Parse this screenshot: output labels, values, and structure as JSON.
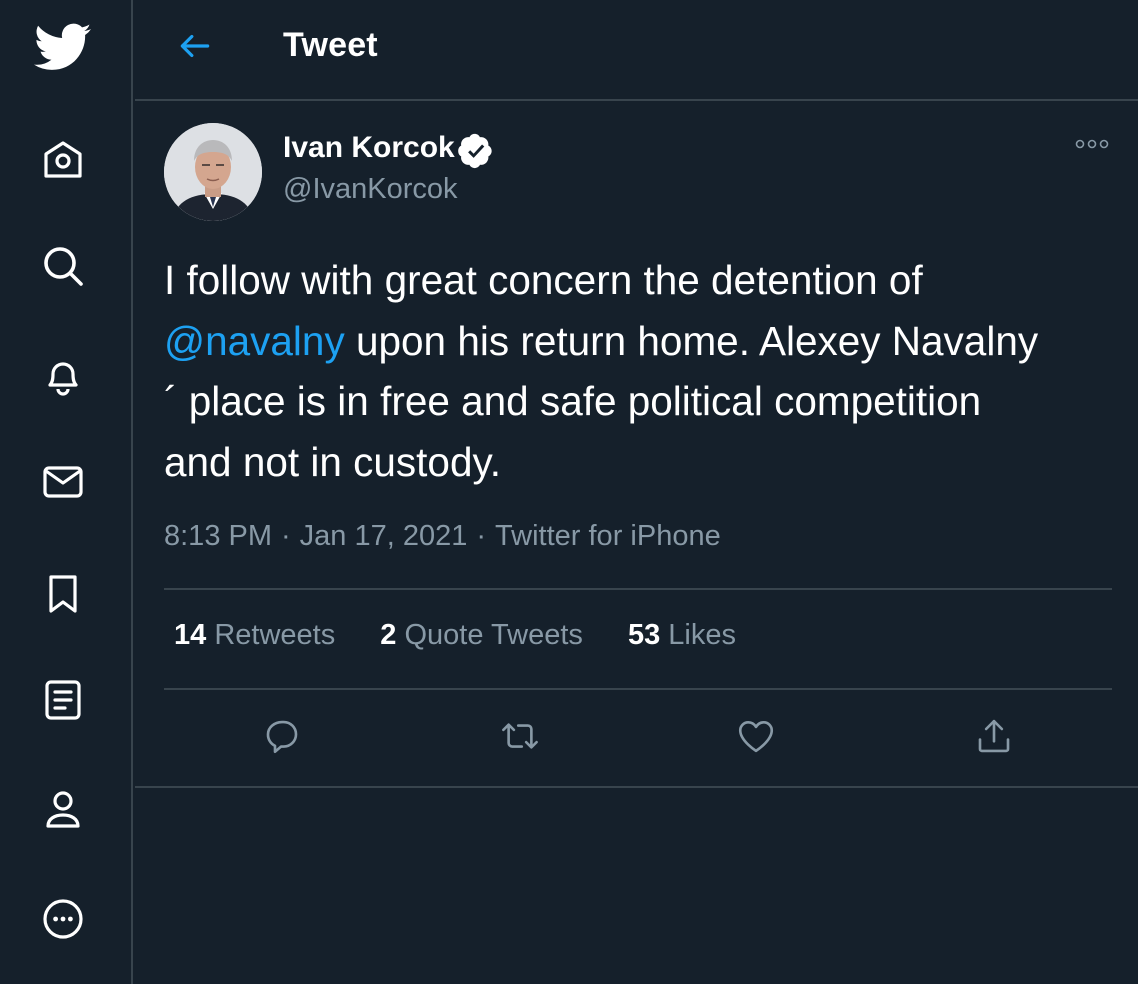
{
  "header": {
    "title": "Tweet",
    "back_icon": "arrow-left-icon"
  },
  "sidebar": {
    "items": [
      {
        "icon": "twitter-logo-icon"
      },
      {
        "icon": "home-icon"
      },
      {
        "icon": "search-icon"
      },
      {
        "icon": "bell-icon"
      },
      {
        "icon": "mail-icon"
      },
      {
        "icon": "bookmark-icon"
      },
      {
        "icon": "list-icon"
      },
      {
        "icon": "profile-icon"
      },
      {
        "icon": "more-icon"
      }
    ]
  },
  "tweet": {
    "author": {
      "display_name": "Ivan Korcok",
      "handle": "@IvanKorcok",
      "verified": true
    },
    "text_before": "I follow with great concern the detention of\n",
    "mention": "@navalny",
    "text_after": " upon his return home. Alexey Navalny\n´ place is in free and safe political competition\nand not in custody.",
    "time": "8:13 PM",
    "date": "Jan 17, 2021",
    "separator": "·",
    "source": "Twitter for iPhone",
    "stats": {
      "retweets_count": "14",
      "retweets_label": "Retweets",
      "quotes_count": "2",
      "quotes_label": "Quote Tweets",
      "likes_count": "53",
      "likes_label": "Likes"
    },
    "actions": [
      "reply-icon",
      "retweet-icon",
      "like-icon",
      "share-icon"
    ]
  },
  "colors": {
    "background": "#15202b",
    "border": "#38444d",
    "accent": "#1da1f2",
    "muted_text": "#8899a6",
    "primary_text": "#ffffff"
  }
}
